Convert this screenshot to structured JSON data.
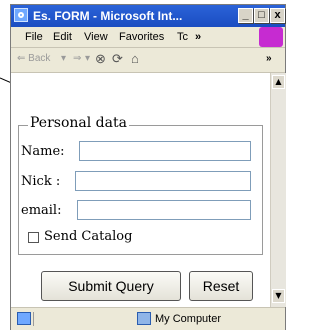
{
  "window": {
    "title": "Es. FORM - Microsoft Int..."
  },
  "title_buttons": {
    "minimize": "_",
    "maximize": "□",
    "close": "x"
  },
  "menu": [
    "File",
    "Edit",
    "View",
    "Favorites",
    "Tc",
    "»"
  ],
  "toolbar": {
    "back": "Back",
    "overflow": "»"
  },
  "form": {
    "legend": "Personal data",
    "fields": [
      {
        "label": "Name:",
        "value": ""
      },
      {
        "label": "Nick :",
        "value": ""
      },
      {
        "label": "email:",
        "value": ""
      }
    ],
    "checkbox_label": "Send Catalog",
    "submit_label": "Submit Query",
    "reset_label": "Reset"
  },
  "statusbar": {
    "zone": "My Computer"
  }
}
